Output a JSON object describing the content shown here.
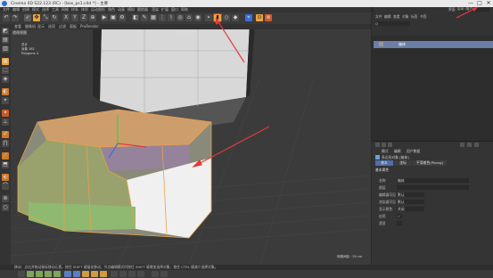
{
  "window": {
    "title": "Cinema 4D S22.123 (RC) - [box_ps1.c4d *] - 主要",
    "minimize": "—",
    "maximize": "□",
    "close": "✕"
  },
  "menu": [
    "文件",
    "编辑",
    "创建",
    "模式",
    "选择",
    "工具",
    "网格",
    "样条",
    "体积",
    "运动图形",
    "角色",
    "动画",
    "模拟",
    "跟踪器",
    "渲染",
    "扩展",
    "窗口",
    "帮助"
  ],
  "right_header": {
    "label": "界面",
    "layout": "启动 (用户) ▾",
    "tabs": [
      "文件",
      "编辑",
      "查看",
      "对象",
      "标签",
      "书签"
    ]
  },
  "viewport": {
    "menu": [
      "查看",
      "摄像机",
      "显示",
      "选项",
      "过滤",
      "面板",
      "ProRender"
    ],
    "label": "透视视图",
    "camera_label": "默认摄像机 ⁰",
    "stats": [
      "总计",
      "对象  181",
      "Polygons  4"
    ],
    "grid_spacing": "网格间距 : 50 cm"
  },
  "object_manager": {
    "search": "Q",
    "selected_object": "箱体"
  },
  "attributes": {
    "tabs_top": [
      "模式",
      "编辑",
      "用户数据"
    ],
    "object_title": "多边形对象 [箱体]",
    "tabs": [
      "基本",
      "坐标",
      "平滑着色(Phong)"
    ],
    "section": "基本属性",
    "rows": [
      {
        "label": "名称",
        "value": "箱体"
      },
      {
        "label": "图层",
        "value": ""
      },
      {
        "label": "编辑器可见",
        "value": "默认"
      },
      {
        "label": "渲染器可见",
        "value": "默认"
      },
      {
        "label": "显示颜色",
        "value": "关闭"
      },
      {
        "label": "启用",
        "value": "✓"
      },
      {
        "label": "透显",
        "value": ""
      }
    ]
  },
  "status": "移动：点击并拖动鼠标移动元素。按住 SHIFT 键量化移动；节点编辑模式时按住 SHIFT 键增加选择对象；按住 CTRL 键减少选择对象。",
  "colors": {
    "accent": "#f0a33a",
    "selection": "#6b7ea8",
    "annotation_arrow": "#e23b3b"
  }
}
